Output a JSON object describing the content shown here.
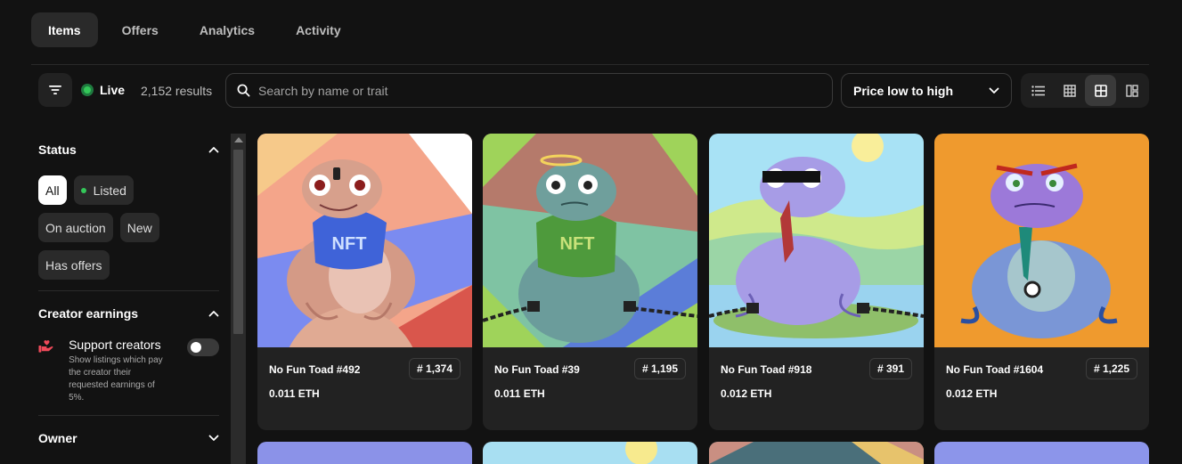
{
  "tabs": [
    {
      "label": "Items",
      "active": true
    },
    {
      "label": "Offers",
      "active": false
    },
    {
      "label": "Analytics",
      "active": false
    },
    {
      "label": "Activity",
      "active": false
    }
  ],
  "toolbar": {
    "live_label": "Live",
    "results_text": "2,152 results",
    "search_placeholder": "Search by name or trait",
    "sort_label": "Price low to high",
    "views": [
      "list-view-icon",
      "compact-grid-icon",
      "large-grid-icon",
      "gallery-view-icon"
    ],
    "active_view": 2
  },
  "sidebar": {
    "status": {
      "title": "Status",
      "pills": [
        "All",
        "Listed",
        "On auction",
        "New",
        "Has offers"
      ],
      "selected": "All"
    },
    "creator_earnings": {
      "title": "Creator earnings",
      "support_title": "Support creators",
      "support_desc": "Show listings which pay the creator their requested earnings of 5%.",
      "toggle_on": false
    },
    "owner": {
      "title": "Owner"
    }
  },
  "cards": [
    {
      "name": "No Fun Toad #492",
      "rank": "# 1,374",
      "price": "0.011 ETH",
      "bg": "#f4a58a",
      "shirt": "NFT"
    },
    {
      "name": "No Fun Toad #39",
      "rank": "# 1,195",
      "price": "0.011 ETH",
      "bg": "#7fc3a3",
      "shirt": "NFT"
    },
    {
      "name": "No Fun Toad #918",
      "rank": "# 391",
      "price": "0.012 ETH",
      "bg": "#a8e2f5",
      "shirt": ""
    },
    {
      "name": "No Fun Toad #1604",
      "rank": "# 1,225",
      "price": "0.012 ETH",
      "bg": "#ef9a2e",
      "shirt": ""
    }
  ],
  "colors": {
    "background": "#121212",
    "surface": "#222222",
    "live_green": "#34c759"
  }
}
